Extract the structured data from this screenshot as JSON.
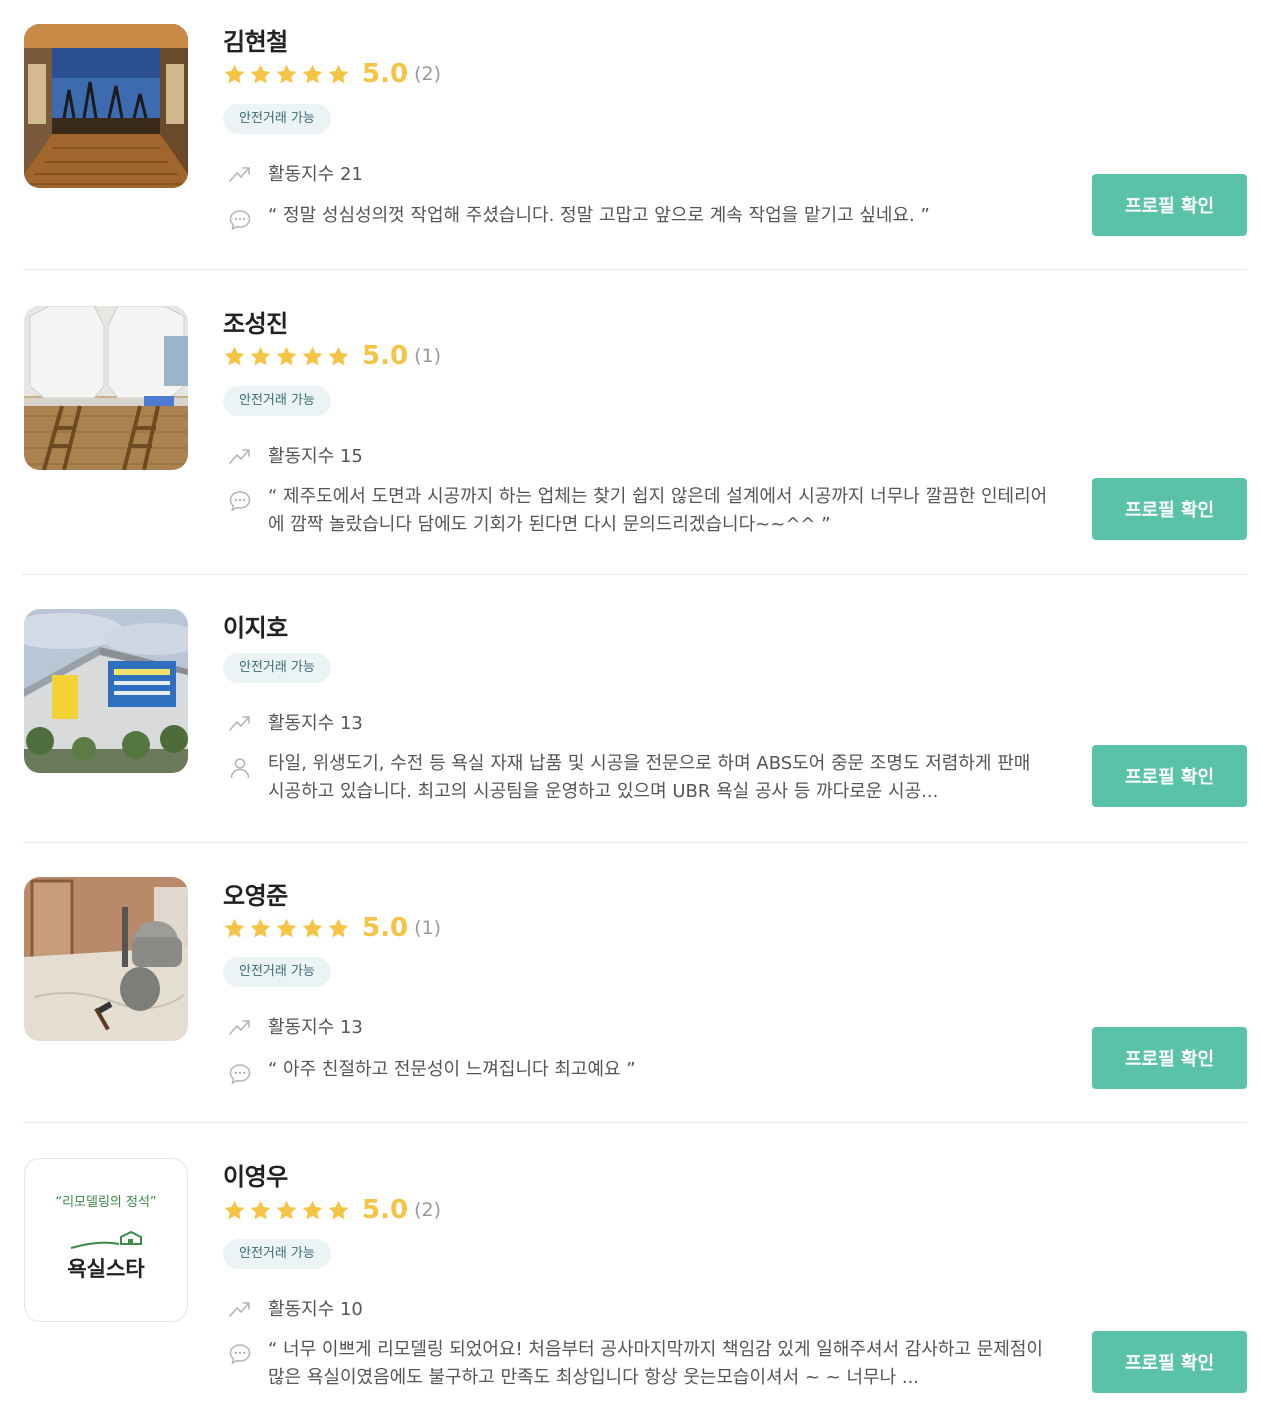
{
  "experts": [
    {
      "name": "김현철",
      "rating": "5.0",
      "review_count": "(2)",
      "stars": 5,
      "badge": "안전거래 가능",
      "activity": "활동지수 21",
      "description": "“ 정말 성심성의껏 작업해 주셨습니다. 정말 고맙고 앞으로 계속 작업을 맡기고 싶네요. ”",
      "desc_icon": "speech-bubble-icon",
      "button": "프로필 확인"
    },
    {
      "name": "조성진",
      "rating": "5.0",
      "review_count": "(1)",
      "stars": 5,
      "badge": "안전거래 가능",
      "activity": "활동지수 15",
      "description": "“ 제주도에서 도면과 시공까지 하는 업체는 찾기 쉽지 않은데 설계에서 시공까지 너무나 깔끔한 인테리어에 깜짝 놀랐습니다 담에도 기회가 된다면 다시 문의드리겠습니다~~^^ ”",
      "desc_icon": "speech-bubble-icon",
      "button": "프로필 확인"
    },
    {
      "name": "이지호",
      "badge": "안전거래 가능",
      "activity": "활동지수 13",
      "description": "타일, 위생도기, 수전 등 욕실 자재 납품 및 시공을 전문으로 하며 ABS도어 중문 조명도 저렴하게 판매 시공하고 있습니다. 최고의 시공팀을 운영하고 있으며 UBR 욕실 공사 등 까다로운 시공...",
      "desc_icon": "person-icon",
      "button": "프로필 확인"
    },
    {
      "name": "오영준",
      "rating": "5.0",
      "review_count": "(1)",
      "stars": 5,
      "badge": "안전거래 가능",
      "activity": "활동지수 13",
      "description": "“ 아주 친절하고 전문성이 느껴집니다 최고예요 ”",
      "desc_icon": "speech-bubble-icon",
      "button": "프로필 확인"
    },
    {
      "name": "이영우",
      "rating": "5.0",
      "review_count": "(2)",
      "stars": 5,
      "badge": "안전거래 가능",
      "activity": "활동지수 10",
      "description": "“ 너무 이쁘게 리모델링 되었어요! 처음부터 공사마지막까지 책임감 있게 일해주셔서 감사하고 문제점이 많은 욕실이였음에도 불구하고 만족도 최상입니다 항상 웃는모습이셔서 ~ ~ 너무나 ...",
      "desc_icon": "speech-bubble-icon",
      "button": "프로필 확인",
      "logo": {
        "slogan": "“리모델링의 정석”",
        "brand": "욕실스타"
      }
    }
  ],
  "colors": {
    "accent": "#5ac2a8",
    "star": "#f6c445",
    "badge_bg": "#ebf3f4"
  }
}
